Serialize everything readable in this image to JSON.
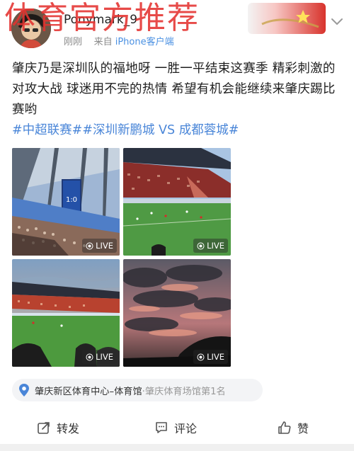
{
  "watermark": "体育官方推荐",
  "header": {
    "username": "Ponymark_9",
    "time": "刚刚",
    "source_prefix": "来自",
    "source": "iPhone客户端",
    "badge_icon": "flag-star-badge-icon",
    "more_icon": "chevron-down-icon"
  },
  "post": {
    "text": "肇庆乃是深圳队的福地呀 一胜一平结束这赛季 精彩刺激的对攻大战 球迷用不完的热情 希望有机会能继续来肇庆踢比赛哟",
    "topics": [
      "#中超联赛#",
      "#深圳新鹏城 VS 成都蓉城#"
    ]
  },
  "gallery": {
    "live_label": "LIVE",
    "scoreboard": "1:0",
    "images": [
      {
        "name": "stadium-scoreboard-photo"
      },
      {
        "name": "stadium-pitch-photo"
      },
      {
        "name": "stadium-sunset-stand-photo"
      },
      {
        "name": "sunset-sky-photo"
      }
    ]
  },
  "location": {
    "icon": "location-pin-icon",
    "venue": "肇庆新区体育中心–体育馆",
    "rank": "·肇庆体育场馆第1名"
  },
  "actions": {
    "repost": "转发",
    "comment": "评论",
    "like": "赞"
  },
  "colors": {
    "accent": "#4a86d8",
    "watermark": "#e4322f",
    "text": "#1f1f1f",
    "meta": "#8a8a8a"
  }
}
